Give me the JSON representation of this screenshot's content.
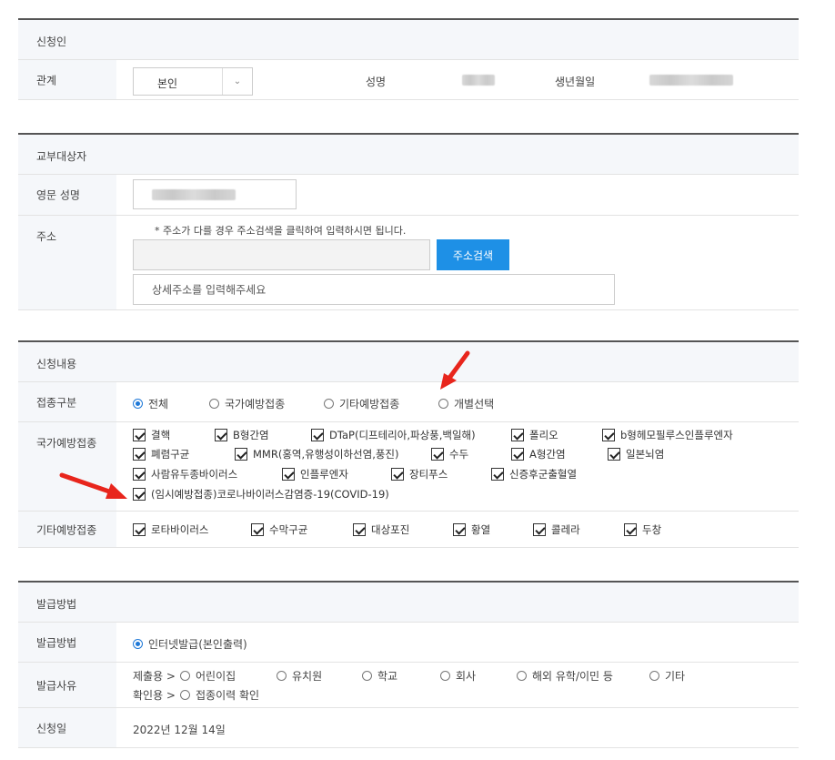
{
  "applicant": {
    "header": "신청인",
    "relation_label": "관계",
    "relation_value": "본인",
    "name_label": "성명",
    "birth_label": "생년월일"
  },
  "recipient": {
    "header": "교부대상자",
    "eng_name_label": "영문 성명",
    "address_label": "주소",
    "address_note": "* 주소가 다를 경우 주소검색을 클릭하여 입력하시면 됩니다.",
    "search_button": "주소검색",
    "detail_placeholder": "상세주소를 입력해주세요"
  },
  "application": {
    "header": "신청내용",
    "type_label": "접종구분",
    "type_options": [
      {
        "label": "전체",
        "selected": true
      },
      {
        "label": "국가예방접종",
        "selected": false
      },
      {
        "label": "기타예방접종",
        "selected": false
      },
      {
        "label": "개별선택",
        "selected": false
      }
    ],
    "national_label": "국가예방접종",
    "national_items": [
      "결핵",
      "B형간염",
      "DTaP(디프테리아,파상풍,백일해)",
      "폴리오",
      "b형헤모필루스인플루엔자",
      "폐렴구균",
      "MMR(홍역,유행성이하선염,풍진)",
      "수두",
      "A형간염",
      "일본뇌염",
      "사람유두종바이러스",
      "인플루엔자",
      "장티푸스",
      "신증후군출혈열",
      "(임시예방접종)코로나바이러스감염증-19(COVID-19)"
    ],
    "other_label": "기타예방접종",
    "other_items": [
      "로타바이러스",
      "수막구균",
      "대상포진",
      "황열",
      "콜레라",
      "두창"
    ]
  },
  "issuance": {
    "header": "발급방법",
    "method_label": "발급방법",
    "method_option": "인터넷발급(본인출력)",
    "reason_label": "발급사유",
    "submit_prefix": "제출용 >",
    "submit_options": [
      "어린이집",
      "유치원",
      "학교",
      "회사",
      "해외 유학/이민 등",
      "기타"
    ],
    "confirm_prefix": "확인용 >",
    "confirm_options": [
      "접종이력 확인"
    ],
    "date_label": "신청일",
    "date_value": "2022년 12월 14일"
  },
  "colors": {
    "accent": "#1e90e6",
    "arrow": "#e8251c",
    "radio_on": "#1e78d7"
  }
}
